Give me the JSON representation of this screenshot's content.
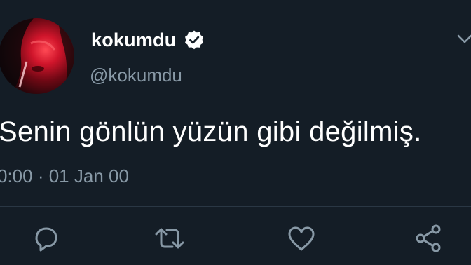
{
  "tweet": {
    "display_name": "kokumdu",
    "handle": "@kokumdu",
    "verified": true,
    "text": "Senin gönlün yüzün gibi değilmiş.",
    "timestamp": "0:00 · 01 Jan 00"
  },
  "actions": [
    {
      "icon": "reply-icon"
    },
    {
      "icon": "retweet-icon"
    },
    {
      "icon": "like-icon"
    },
    {
      "icon": "share-icon"
    }
  ],
  "colors": {
    "background": "#141d26",
    "primary_text": "#ffffff",
    "secondary_text": "#8899a6",
    "icon": "#8899a6",
    "divider": "#2a3744"
  }
}
